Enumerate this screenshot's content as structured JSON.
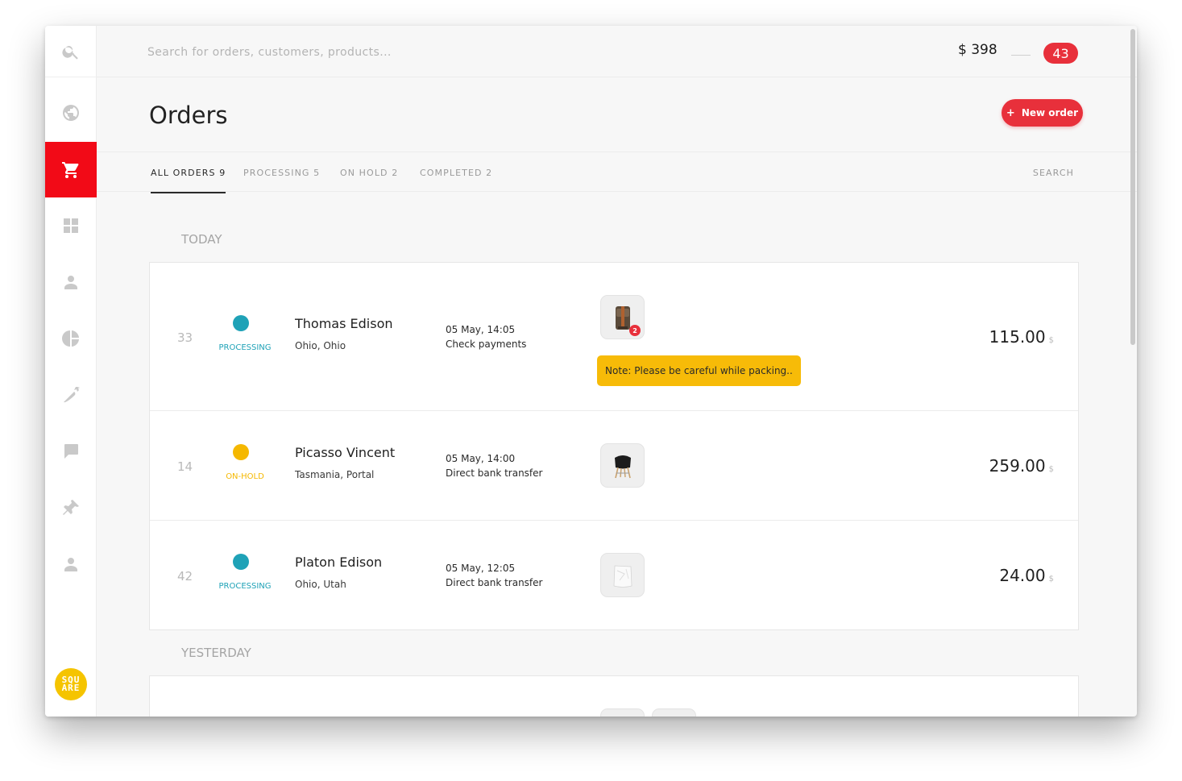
{
  "sidebar": {
    "items": [
      {
        "icon": "search-icon"
      },
      {
        "icon": "globe-icon"
      },
      {
        "icon": "cart-icon",
        "active": true
      },
      {
        "icon": "dashboard-grid-icon"
      },
      {
        "icon": "user-icon"
      },
      {
        "icon": "pie-chart-icon"
      },
      {
        "icon": "carrot-icon"
      },
      {
        "icon": "chat-icon"
      },
      {
        "icon": "pin-icon"
      },
      {
        "icon": "user-icon"
      }
    ],
    "logo_lines": [
      "SQU",
      "ARE"
    ]
  },
  "topbar": {
    "search_placeholder": "Search for orders, customers, products...",
    "balance": "$ 398",
    "notifications": "43"
  },
  "header": {
    "title": "Orders",
    "new_order_plus": "+",
    "new_order_label": "New order"
  },
  "tabs": [
    {
      "label": "ALL ORDERS 9",
      "active": true
    },
    {
      "label": "PROCESSING 5"
    },
    {
      "label": "ON HOLD 2"
    },
    {
      "label": "COMPLETED 2"
    }
  ],
  "tab_search": "SEARCH",
  "sections": {
    "today": "TODAY",
    "yesterday": "YESTERDAY"
  },
  "orders": [
    {
      "id": "33",
      "status": "PROCESSING",
      "status_color": "#1fa2b7",
      "name": "Thomas Edison",
      "location": "Ohio, Ohio",
      "date": "05 May, 14:05",
      "payment": "Check payments",
      "product_icon": "backpack-icon",
      "quantity": "2",
      "note": "Note: Please be careful while packing..",
      "price": "115.00",
      "currency": "$"
    },
    {
      "id": "14",
      "status": "ON-HOLD",
      "status_color": "#f5b800",
      "name": "Picasso Vincent",
      "location": "Tasmania, Portal",
      "date": "05 May, 14:00",
      "payment": "Direct bank transfer",
      "product_icon": "chair-icon",
      "price": "259.00",
      "currency": "$"
    },
    {
      "id": "42",
      "status": "PROCESSING",
      "status_color": "#1fa2b7",
      "name": "Platon Edison",
      "location": "Ohio, Utah",
      "date": "05 May, 12:05",
      "payment": "Direct bank transfer",
      "product_icon": "paper-bag-icon",
      "price": "24.00",
      "currency": "$"
    }
  ],
  "colors": {
    "accent": "#e8303b",
    "active_nav": "#f20a17",
    "processing": "#1fa2b7",
    "on_hold": "#f5b800",
    "note": "#f7bb08"
  }
}
